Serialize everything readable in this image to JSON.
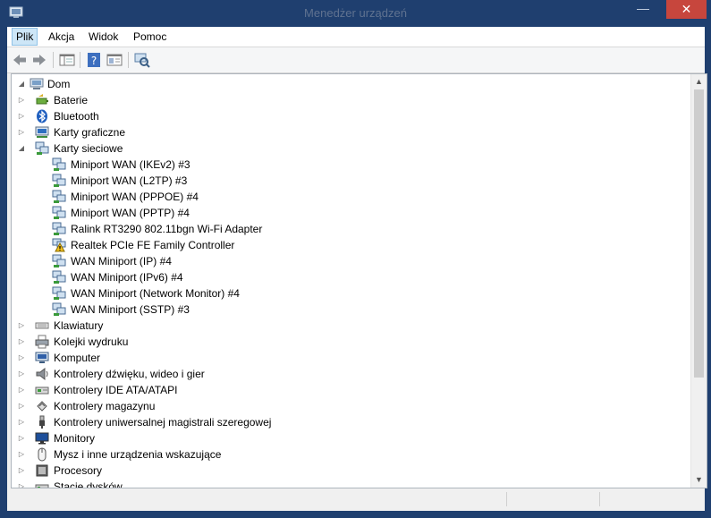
{
  "window": {
    "title": "Menedżer urządzeń",
    "minimize": "—",
    "close": "✕"
  },
  "menu": [
    {
      "label": "Plik",
      "active": true
    },
    {
      "label": "Akcja"
    },
    {
      "label": "Widok"
    },
    {
      "label": "Pomoc"
    }
  ],
  "toolbar": [
    "back-icon",
    "forward-icon",
    "console-tree-icon",
    "help-icon",
    "properties-icon",
    "scan-hardware-icon"
  ],
  "tree": {
    "root": "Dom",
    "items": [
      {
        "label": "Baterie",
        "icon": "battery-icon",
        "level": 1,
        "state": "collapsed"
      },
      {
        "label": "Bluetooth",
        "icon": "bluetooth-icon",
        "level": 1,
        "state": "collapsed"
      },
      {
        "label": "Karty graficzne",
        "icon": "display-adapter-icon",
        "level": 1,
        "state": "collapsed"
      },
      {
        "label": "Karty sieciowe",
        "icon": "network-adapter-icon",
        "level": 1,
        "state": "expanded"
      },
      {
        "label": "Miniport WAN (IKEv2) #3",
        "icon": "network-adapter-icon",
        "level": 2
      },
      {
        "label": "Miniport WAN (L2TP) #3",
        "icon": "network-adapter-icon",
        "level": 2
      },
      {
        "label": "Miniport WAN (PPPOE) #4",
        "icon": "network-adapter-icon",
        "level": 2
      },
      {
        "label": "Miniport WAN (PPTP) #4",
        "icon": "network-adapter-icon",
        "level": 2
      },
      {
        "label": "Ralink RT3290 802.11bgn Wi-Fi Adapter",
        "icon": "network-adapter-icon",
        "level": 2
      },
      {
        "label": "Realtek PCIe FE Family Controller",
        "icon": "warning-network-adapter-icon",
        "level": 2
      },
      {
        "label": "WAN Miniport (IP) #4",
        "icon": "network-adapter-icon",
        "level": 2
      },
      {
        "label": "WAN Miniport (IPv6) #4",
        "icon": "network-adapter-icon",
        "level": 2
      },
      {
        "label": "WAN Miniport (Network Monitor) #4",
        "icon": "network-adapter-icon",
        "level": 2
      },
      {
        "label": "WAN Miniport (SSTP) #3",
        "icon": "network-adapter-icon",
        "level": 2
      },
      {
        "label": "Klawiatury",
        "icon": "keyboard-icon",
        "level": 1,
        "state": "collapsed"
      },
      {
        "label": "Kolejki wydruku",
        "icon": "printer-icon",
        "level": 1,
        "state": "collapsed"
      },
      {
        "label": "Komputer",
        "icon": "computer-icon",
        "level": 1,
        "state": "collapsed"
      },
      {
        "label": "Kontrolery dźwięku, wideo i gier",
        "icon": "speaker-icon",
        "level": 1,
        "state": "collapsed"
      },
      {
        "label": "Kontrolery IDE ATA/ATAPI",
        "icon": "ide-controller-icon",
        "level": 1,
        "state": "collapsed"
      },
      {
        "label": "Kontrolery magazynu",
        "icon": "storage-controller-icon",
        "level": 1,
        "state": "collapsed"
      },
      {
        "label": "Kontrolery uniwersalnej magistrali szeregowej",
        "icon": "usb-icon",
        "level": 1,
        "state": "collapsed"
      },
      {
        "label": "Monitory",
        "icon": "monitor-icon",
        "level": 1,
        "state": "collapsed"
      },
      {
        "label": "Mysz i inne urządzenia wskazujące",
        "icon": "mouse-icon",
        "level": 1,
        "state": "collapsed"
      },
      {
        "label": "Procesory",
        "icon": "processor-icon",
        "level": 1,
        "state": "collapsed"
      },
      {
        "label": "Stacje dysków",
        "icon": "disk-drive-icon",
        "level": 1,
        "state": "collapsed"
      }
    ]
  },
  "scrollbar": {
    "up": "▲",
    "down": "▼"
  }
}
